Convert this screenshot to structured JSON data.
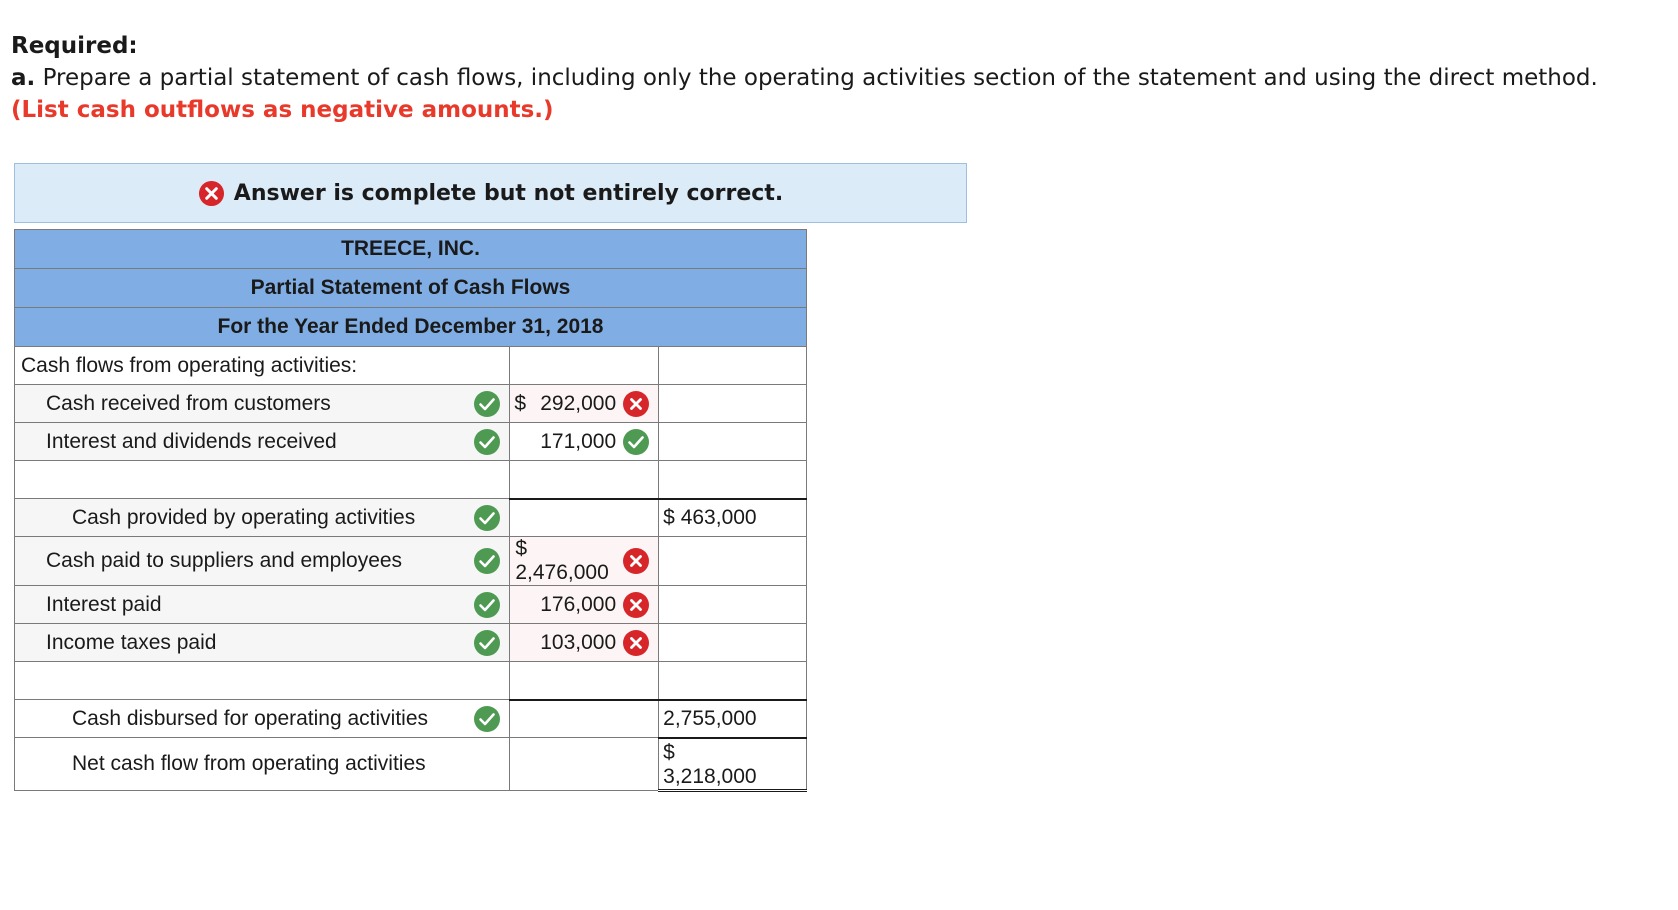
{
  "instructions": {
    "required": "Required:",
    "part_label": "a.",
    "text": " Prepare a partial statement of cash flows, including only the operating activities section of the statement and using the direct method.",
    "note": "(List cash outflows as negative amounts.)"
  },
  "feedback": {
    "message": "Answer is complete but not entirely correct.",
    "status_icon": "x-circle-icon"
  },
  "statement": {
    "company": "TREECE, INC.",
    "title": "Partial Statement of Cash Flows",
    "period": "For the Year Ended December 31, 2018",
    "section_header": "Cash flows from operating activities:",
    "rows": [
      {
        "label": "Cash received from customers",
        "label_status": "correct",
        "dollar": "$",
        "amount": "292,000",
        "amount_status": "incorrect",
        "total": ""
      },
      {
        "label": "Interest and dividends received",
        "label_status": "correct",
        "dollar": "",
        "amount": "171,000",
        "amount_status": "correct",
        "total": ""
      },
      {
        "label": "Cash provided by operating activities",
        "label_status": "correct",
        "dollar": "$",
        "amount": "",
        "total": "463,000"
      },
      {
        "label": "Cash paid to suppliers and employees",
        "label_status": "correct",
        "dollar": "$",
        "amount": "2,476,000",
        "amount_status": "incorrect",
        "total": ""
      },
      {
        "label": "Interest paid",
        "label_status": "correct",
        "dollar": "",
        "amount": "176,000",
        "amount_status": "incorrect",
        "total": ""
      },
      {
        "label": "Income taxes paid",
        "label_status": "correct",
        "dollar": "",
        "amount": "103,000",
        "amount_status": "incorrect",
        "total": ""
      },
      {
        "label": "Cash disbursed for operating activities",
        "label_status": "correct",
        "dollar": "",
        "amount": "",
        "total": "2,755,000"
      },
      {
        "label": "Net cash flow from operating activities",
        "dollar": "$",
        "total": "3,218,000"
      }
    ]
  },
  "colors": {
    "header_blue": "#80aee4",
    "banner_bg": "#dcebf8",
    "correct_green": "#4e9a52",
    "incorrect_red": "#d6262a",
    "note_red": "#e8392b"
  }
}
